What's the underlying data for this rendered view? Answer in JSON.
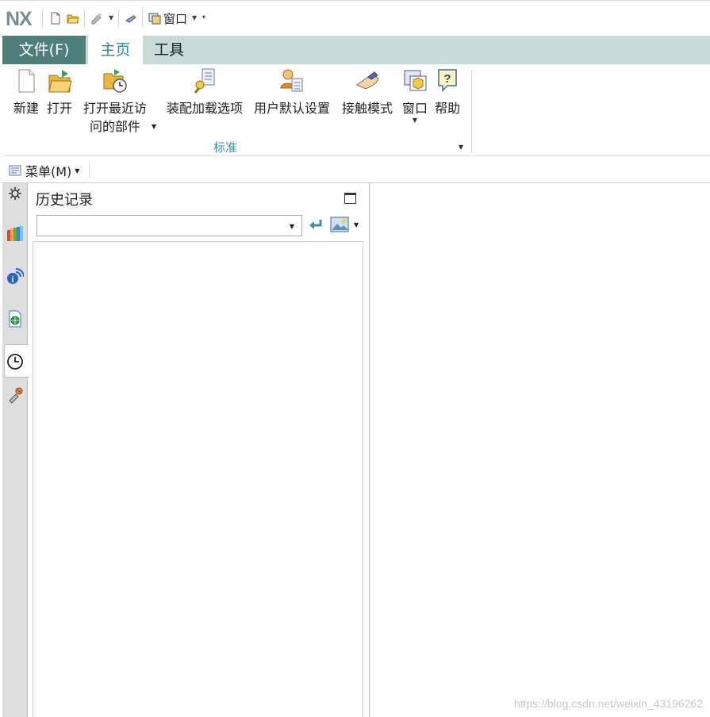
{
  "app": {
    "logo": "NX"
  },
  "quick_access": {
    "window_label": "窗口",
    "icons": [
      "new-file-icon",
      "open-folder-icon",
      "repeat-command-icon",
      "touch-mode-icon",
      "window-icon"
    ]
  },
  "tabs": [
    {
      "label": "文件(F)",
      "active": false
    },
    {
      "label": "主页",
      "active": true
    },
    {
      "label": "工具",
      "active": false
    }
  ],
  "ribbon": {
    "group_label": "标准",
    "buttons": {
      "new": "新建",
      "open": "打开",
      "recent_line1": "打开最近访",
      "recent_line2": "问的部件",
      "load_options": "装配加载选项",
      "user_defaults": "用户默认设置",
      "touch_mode": "接触模式",
      "window": "窗口",
      "help": "帮助"
    }
  },
  "menubar": {
    "menu_label": "菜单(M)"
  },
  "resource_bar": {
    "icons": [
      "settings-icon",
      "part-navigator-icon",
      "info-icon",
      "web-browser-icon",
      "history-clock-icon",
      "reuse-library-icon"
    ],
    "active": "history-clock-icon"
  },
  "history_panel": {
    "title": "历史记录",
    "combo_value": ""
  },
  "graphics": {
    "watermark": "https://blog.csdn.net/weixin_43196262"
  },
  "colors": {
    "file_tab": "#4d7f7b",
    "tab_bar": "#c8dad8",
    "active_tab_text": "#2a8aa0",
    "group_label": "#3b8ea8"
  }
}
